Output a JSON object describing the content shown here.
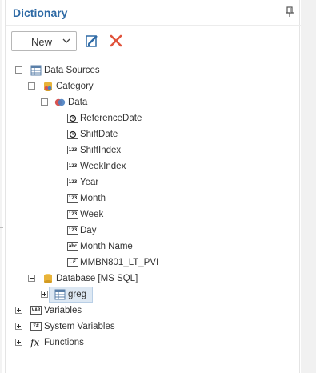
{
  "panel": {
    "title": "Dictionary"
  },
  "toolbar": {
    "new_label": "New"
  },
  "tree": {
    "data_sources": "Data Sources",
    "category": "Category",
    "data": "Data",
    "fields": [
      {
        "type": "datetime",
        "label": "ReferenceDate"
      },
      {
        "type": "datetime",
        "label": "ShiftDate"
      },
      {
        "type": "int",
        "label": "ShiftIndex"
      },
      {
        "type": "int",
        "label": "WeekIndex"
      },
      {
        "type": "int",
        "label": "Year"
      },
      {
        "type": "int",
        "label": "Month"
      },
      {
        "type": "int",
        "label": "Week"
      },
      {
        "type": "int",
        "label": "Day"
      },
      {
        "type": "string",
        "label": "Month Name"
      },
      {
        "type": "expression",
        "label": "MMBN801_LT_PVI"
      }
    ],
    "database": "Database [MS SQL]",
    "greg": "greg",
    "variables": "Variables",
    "system_variables": "System Variables",
    "functions": "Functions"
  },
  "badges": {
    "int": "123",
    "string": "abc",
    "expression": ".E",
    "var": "VAR",
    "sys": "Σ#"
  },
  "colors": {
    "title": "#2e6aa5",
    "accent_blue": "#2e6aa5",
    "delete_red": "#e0533b",
    "database_gold": "#e8b339",
    "selection": "#dde8f3"
  }
}
